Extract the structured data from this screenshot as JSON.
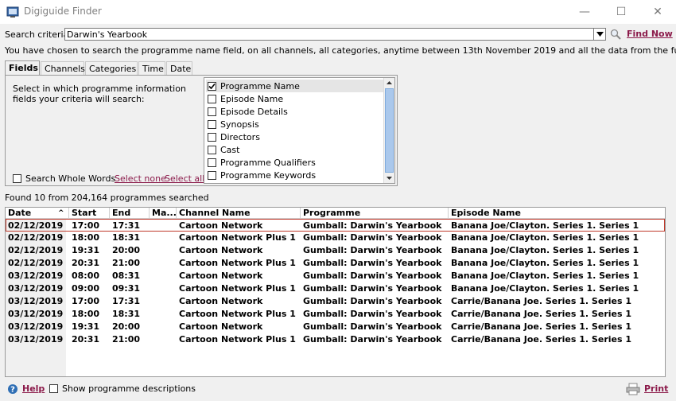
{
  "window": {
    "title": "Digiguide Finder",
    "minimize": "—",
    "maximize": "☐",
    "close": "✕"
  },
  "search": {
    "label": "Search criteria:",
    "value": "Darwin's Yearbook",
    "find_now": "Find Now"
  },
  "description": "You have chosen to search the programme name field, on all channels, all categories, anytime between 13th November 2019 and all the data from the future",
  "tabs": [
    {
      "label": "Fields"
    },
    {
      "label": "Channels"
    },
    {
      "label": "Categories"
    },
    {
      "label": "Time"
    },
    {
      "label": "Date"
    }
  ],
  "fields_panel": {
    "help": "Select in which programme information fields your criteria will search:",
    "whole_words": "Search Whole Words",
    "select_none": "Select none",
    "select_all": "Select all",
    "items": [
      {
        "label": "Programme Name",
        "checked": true
      },
      {
        "label": "Episode Name",
        "checked": false
      },
      {
        "label": "Episode Details",
        "checked": false
      },
      {
        "label": "Synopsis",
        "checked": false
      },
      {
        "label": "Directors",
        "checked": false
      },
      {
        "label": "Cast",
        "checked": false
      },
      {
        "label": "Programme Qualifiers",
        "checked": false
      },
      {
        "label": "Programme Keywords",
        "checked": false
      }
    ]
  },
  "found_text": "Found 10 from 204,164 programmes searched",
  "results": {
    "columns": [
      "Date",
      "Start",
      "End",
      "Ma...",
      "Channel Name",
      "Programme",
      "Episode Name"
    ],
    "sort_indicator": "^",
    "rows": [
      [
        "02/12/2019",
        "17:00",
        "17:31",
        "",
        "Cartoon Network",
        "Gumball: Darwin's Yearbook",
        "Banana Joe/Clayton. Series 1. Series 1"
      ],
      [
        "02/12/2019",
        "18:00",
        "18:31",
        "",
        "Cartoon Network Plus 1",
        "Gumball: Darwin's Yearbook",
        "Banana Joe/Clayton. Series 1. Series 1"
      ],
      [
        "02/12/2019",
        "19:31",
        "20:00",
        "",
        "Cartoon Network",
        "Gumball: Darwin's Yearbook",
        "Banana Joe/Clayton. Series 1. Series 1"
      ],
      [
        "02/12/2019",
        "20:31",
        "21:00",
        "",
        "Cartoon Network Plus 1",
        "Gumball: Darwin's Yearbook",
        "Banana Joe/Clayton. Series 1. Series 1"
      ],
      [
        "03/12/2019",
        "08:00",
        "08:31",
        "",
        "Cartoon Network",
        "Gumball: Darwin's Yearbook",
        "Banana Joe/Clayton. Series 1. Series 1"
      ],
      [
        "03/12/2019",
        "09:00",
        "09:31",
        "",
        "Cartoon Network Plus 1",
        "Gumball: Darwin's Yearbook",
        "Banana Joe/Clayton. Series 1. Series 1"
      ],
      [
        "03/12/2019",
        "17:00",
        "17:31",
        "",
        "Cartoon Network",
        "Gumball: Darwin's Yearbook",
        "Carrie/Banana Joe. Series 1. Series 1"
      ],
      [
        "03/12/2019",
        "18:00",
        "18:31",
        "",
        "Cartoon Network Plus 1",
        "Gumball: Darwin's Yearbook",
        "Carrie/Banana Joe. Series 1. Series 1"
      ],
      [
        "03/12/2019",
        "19:31",
        "20:00",
        "",
        "Cartoon Network",
        "Gumball: Darwin's Yearbook",
        "Carrie/Banana Joe. Series 1. Series 1"
      ],
      [
        "03/12/2019",
        "20:31",
        "21:00",
        "",
        "Cartoon Network Plus 1",
        "Gumball: Darwin's Yearbook",
        "Carrie/Banana Joe. Series 1. Series 1"
      ]
    ]
  },
  "footer": {
    "help": "Help",
    "show_descriptions": "Show programme descriptions",
    "print": "Print"
  },
  "colors": {
    "link": "#8b1a4a",
    "selection_border": "#c0392b",
    "scroll_thumb": "#aac8ec"
  }
}
